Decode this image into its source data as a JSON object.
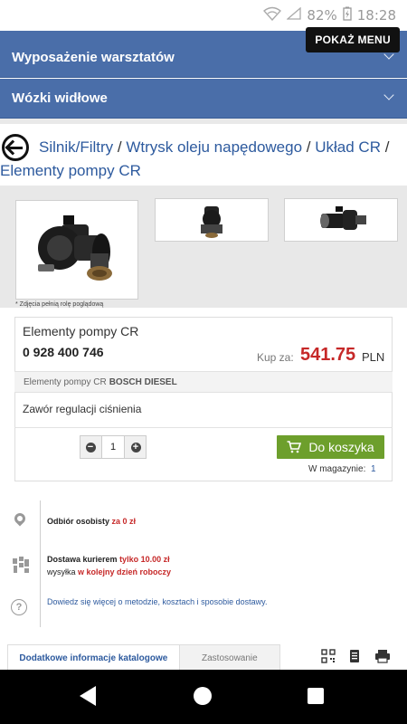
{
  "status_bar": {
    "battery": "82%",
    "time": "18:28"
  },
  "header": {
    "menu_button": "POKAŻ MENU",
    "categories": [
      {
        "label": "Wyposażenie warsztatów"
      },
      {
        "label": "Wózki widłowe"
      }
    ]
  },
  "breadcrumb": {
    "items": [
      "Silnik/Filtry",
      "Wtrysk oleju napędowego",
      "Układ CR",
      "Elementy pompy CR"
    ],
    "separator": "/"
  },
  "gallery": {
    "note": "* Zdjęcia pełnią rolę poglądową"
  },
  "product": {
    "name": "Elementy pompy CR",
    "code": "0 928 400 746",
    "price_label": "Kup za:",
    "price": "541.75",
    "currency": "PLN",
    "brand_prefix": "Elementy pompy CR",
    "brand": "BOSCH DIESEL",
    "description": "Zawór regulacji ciśnienia",
    "quantity": "1",
    "add_to_cart": "Do koszyka",
    "stock_label": "W magazynie:",
    "stock_value": "1"
  },
  "shipping": {
    "pickup": {
      "text": "Odbiór osobisty",
      "highlight": "za 0 zł"
    },
    "courier": {
      "text": "Dostawa kurierem",
      "highlight": "tylko 10.00 zł",
      "line2_prefix": "wysyłka",
      "line2_highlight": "w kolejny dzień roboczy"
    },
    "more_info": "Dowiedz się więcej o metodzie, kosztach i sposobie dostawy."
  },
  "tabs": [
    {
      "label": "Dodatkowe informacje katalogowe"
    },
    {
      "label": "Zastosowanie"
    }
  ],
  "icons": {
    "qr": "qr-code-icon",
    "document": "document-icon",
    "print": "printer-icon"
  }
}
